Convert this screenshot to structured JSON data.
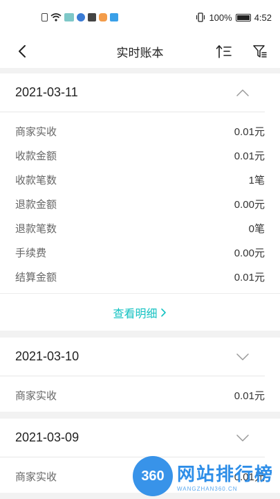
{
  "statusbar": {
    "battery": "100%",
    "time": "4:52"
  },
  "navbar": {
    "title": "实时账本"
  },
  "cards": [
    {
      "date": "2021-03-11",
      "expanded": true,
      "rows": [
        {
          "label": "商家实收",
          "value": "0.01元"
        },
        {
          "label": "收款金额",
          "value": "0.01元"
        },
        {
          "label": "收款笔数",
          "value": "1笔"
        },
        {
          "label": "退款金额",
          "value": "0.00元"
        },
        {
          "label": "退款笔数",
          "value": "0笔"
        },
        {
          "label": "手续费",
          "value": "0.00元"
        },
        {
          "label": "结算金额",
          "value": "0.01元"
        }
      ],
      "detail_label": "查看明细"
    },
    {
      "date": "2021-03-10",
      "expanded": false,
      "rows": [
        {
          "label": "商家实收",
          "value": "0.01元"
        }
      ]
    },
    {
      "date": "2021-03-09",
      "expanded": false,
      "rows": [
        {
          "label": "商家实收",
          "value": "0.01元"
        }
      ]
    }
  ],
  "watermark": {
    "logo": "360",
    "name": "网站排行榜",
    "url": "WANGZHAN360.CN"
  },
  "colors": {
    "accent": "#13c2c2",
    "background": "#f2f2f2",
    "watermark": "#2e8ee8"
  }
}
